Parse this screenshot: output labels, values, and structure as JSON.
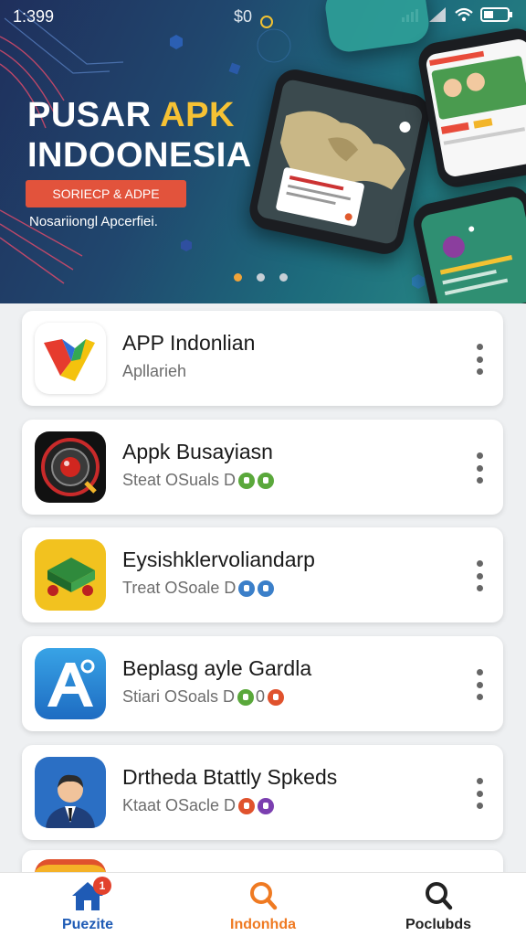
{
  "status_bar": {
    "time": "1:399",
    "center": "$0"
  },
  "hero": {
    "title_line1_white": "PUSAR ",
    "title_line1_accent": "APK",
    "title_line2": "INDOONESIA",
    "button_label": "SORIECP & ADPE",
    "subtitle": "Nosariiongl Apcerfiei.",
    "carousel_count": 3,
    "carousel_active": 1,
    "colors": {
      "accent": "#f6c234",
      "button": "#e2533c"
    }
  },
  "apps": [
    {
      "name": "APP Indonlian",
      "meta": "Apllarieh",
      "icon": "colorful-folded-logo-icon",
      "badges": []
    },
    {
      "name": "Appk Busayiasn",
      "meta": "Steat OSuals D",
      "icon": "red-camera-lens-icon",
      "badges": [
        "#5aa83b",
        "#5aa83b"
      ]
    },
    {
      "name": "Eysishklervoliandarp",
      "meta": "Treat OSoale D",
      "icon": "green-device-cart-icon",
      "badges": [
        "#3b7fc9",
        "#3b7fc9"
      ]
    },
    {
      "name": "Beplasg ayle Gardla",
      "meta": "Stiari OSoals D",
      "icon": "blue-letter-a-icon",
      "badges_text": "0",
      "badges": [
        "#5aa83b",
        "#e0522d"
      ]
    },
    {
      "name": "Drtheda Btattly Spkeds",
      "meta": "Ktaat OSacle D",
      "icon": "businessman-avatar-icon",
      "badges": [
        "#e0522d",
        "#7b3fb0"
      ]
    }
  ],
  "bottom_nav": [
    {
      "label": "Puezite",
      "icon": "home-icon",
      "color": "#1f5bb5",
      "badge": "1"
    },
    {
      "label": "Indonhda",
      "icon": "search-icon",
      "color": "#ef7a22",
      "badge": ""
    },
    {
      "label": "Poclubds",
      "icon": "search-icon",
      "color": "#222222",
      "badge": ""
    }
  ]
}
